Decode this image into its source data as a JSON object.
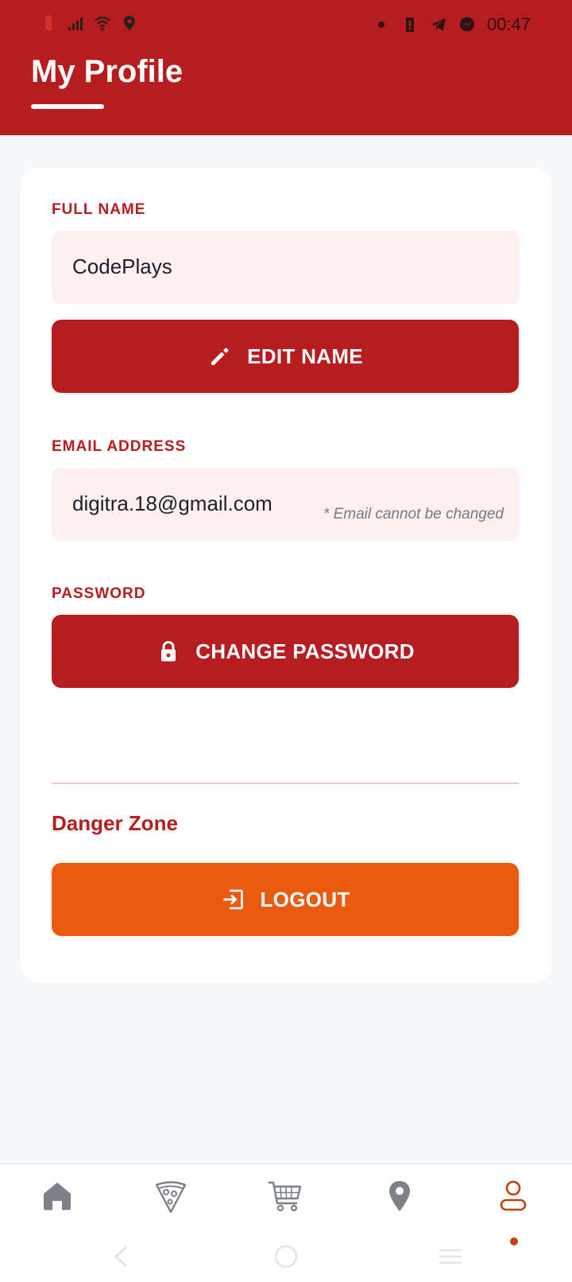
{
  "status_bar": {
    "time": "00:47",
    "left_icons": [
      "battery-low-icon",
      "signal-icon",
      "wifi-icon",
      "location-icon"
    ],
    "right_icons": [
      "notification-dot-icon",
      "battery-saver-icon",
      "telegram-icon",
      "messenger-icon"
    ]
  },
  "header": {
    "title": "My Profile"
  },
  "profile": {
    "full_name_label": "FULL NAME",
    "full_name_value": "CodePlays",
    "edit_name_label": "EDIT NAME",
    "email_label": "EMAIL ADDRESS",
    "email_value": "digitra.18@gmail.com",
    "email_note": "* Email cannot be changed",
    "password_label": "PASSWORD",
    "change_password_label": "CHANGE PASSWORD",
    "danger_zone_title": "Danger Zone",
    "logout_label": "LOGOUT"
  },
  "bottom_nav": {
    "items": [
      {
        "icon": "home-icon",
        "active": false
      },
      {
        "icon": "pizza-icon",
        "active": false
      },
      {
        "icon": "cart-icon",
        "active": false
      },
      {
        "icon": "location-pin-icon",
        "active": false
      },
      {
        "icon": "profile-icon",
        "active": true
      }
    ]
  },
  "colors": {
    "primary": "#b71c1f",
    "accent_orange": "#ea5a11",
    "field_bg": "#fdf0ef",
    "page_bg": "#f7f8fa",
    "active_nav": "#c2410c"
  }
}
